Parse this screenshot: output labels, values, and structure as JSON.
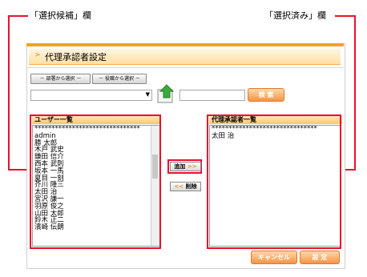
{
  "callouts": {
    "left": "「選択候補」欄",
    "right": "「選択済み」欄"
  },
  "panel": {
    "title": "代理承認者設定"
  },
  "toolbar": {
    "dept_button": "－ 部署から選択 －",
    "role_button": "－ 役職から選択 －",
    "search_button": "検 索"
  },
  "user_list": {
    "header": "ユーザー一覧",
    "items": [
      "*******************************",
      "admin",
      "勝 太郎",
      "木戸 武史",
      "鎌田 信介",
      "西本 武則",
      "坂本 一馬",
      "夏目 一刻",
      "芥川 隆三",
      "太田 治",
      "宮沢 謙一",
      "羽原 俊之",
      "山田 太郎",
      "鈴木 正二",
      "濱崎 伝朗"
    ]
  },
  "actions": {
    "add_label": "追加",
    "add_arrows": ">>",
    "remove_arrows": "<<",
    "remove_label": "削除"
  },
  "approver_list": {
    "header": "代理承認者一覧",
    "items": [
      "*******************************",
      "太田 治"
    ]
  },
  "footer": {
    "cancel": "キャンセル",
    "confirm": "設 定"
  },
  "colors": {
    "accent_red": "#e8102e",
    "orange": "#f49447"
  }
}
